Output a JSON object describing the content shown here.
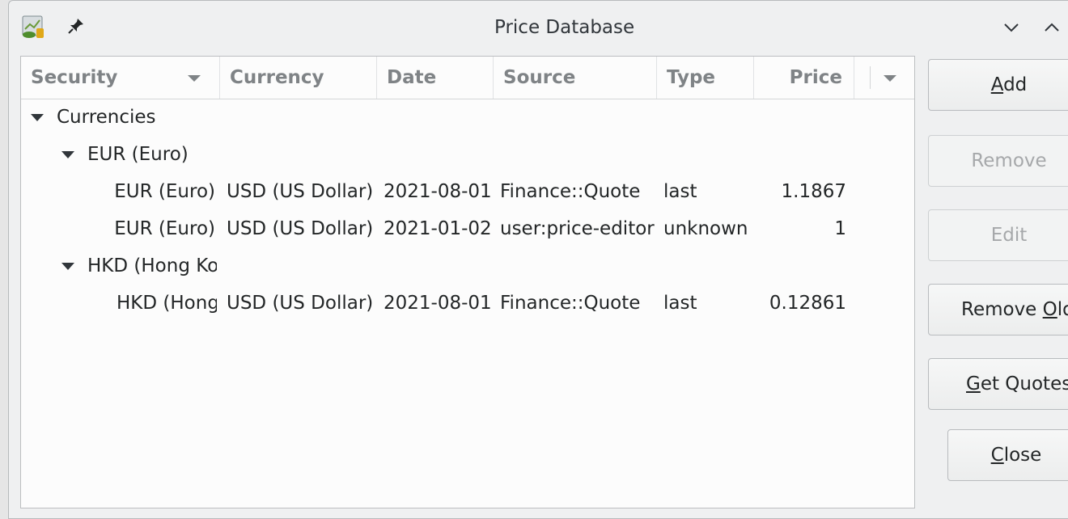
{
  "window": {
    "title": "Price Database"
  },
  "icons": {
    "app": "gnucash-price-icon",
    "pin": "pin-icon",
    "minimize": "chevron-down-icon",
    "maximize": "chevron-up-icon"
  },
  "table": {
    "columns": [
      "Security",
      "Currency",
      "Date",
      "Source",
      "Type",
      "Price"
    ],
    "groups": [
      {
        "label": "Currencies",
        "children": [
          {
            "label": "EUR (Euro)",
            "rows": [
              [
                "EUR (Euro)",
                "USD (US Dollar)",
                "2021-08-01",
                "Finance::Quote",
                "last",
                "1.1867"
              ],
              [
                "EUR (Euro)",
                "USD (US Dollar)",
                "2021-01-02",
                "user:price-editor",
                "unknown",
                "1"
              ]
            ]
          },
          {
            "label": "HKD (Hong Kong Dollar)",
            "rows": [
              [
                "HKD (Hong Kong Dollar)",
                "USD (US Dollar)",
                "2021-08-01",
                "Finance::Quote",
                "last",
                "0.12861"
              ]
            ]
          }
        ]
      }
    ]
  },
  "buttons": {
    "add": {
      "pre": "",
      "mnemonic": "A",
      "post": "dd",
      "enabled": true
    },
    "remove": {
      "label": "Remove",
      "enabled": false
    },
    "edit": {
      "label": "Edit",
      "enabled": false
    },
    "remove_old": {
      "pre": "Remove ",
      "mnemonic": "O",
      "post": "ld...",
      "enabled": true
    },
    "get_quotes": {
      "pre": "",
      "mnemonic": "G",
      "post": "et Quotes",
      "enabled": true
    },
    "close": {
      "pre": "",
      "mnemonic": "C",
      "post": "lose",
      "enabled": true
    }
  }
}
